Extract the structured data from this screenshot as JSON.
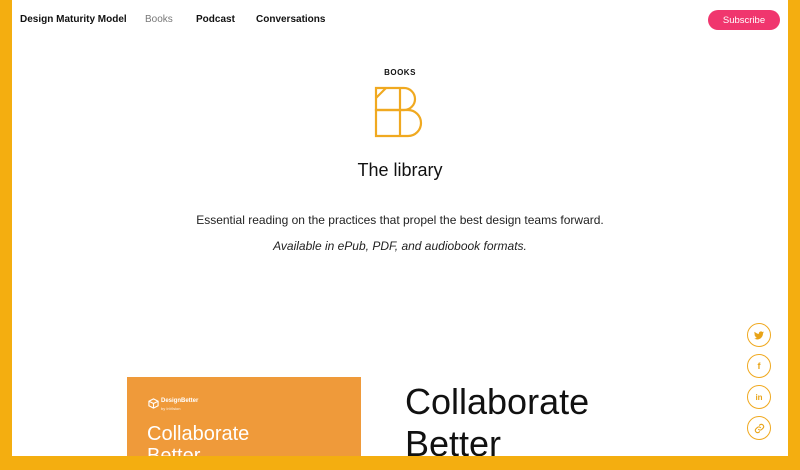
{
  "nav": {
    "brand": "Design Maturity Model",
    "items": [
      "Books",
      "Podcast",
      "Conversations"
    ],
    "subscribe": "Subscribe"
  },
  "header": {
    "eyebrow": "BOOKS",
    "title": "The library",
    "description": "Essential reading on the practices that propel the best design teams forward.",
    "formats": "Available in ePub, PDF, and audiobook formats."
  },
  "social": [
    {
      "icon": "twitter-icon",
      "glyph": "🐦"
    },
    {
      "icon": "facebook-icon",
      "glyph": "f"
    },
    {
      "icon": "linkedin-icon",
      "glyph": "in"
    },
    {
      "icon": "link-icon",
      "glyph": "🔗"
    }
  ],
  "book": {
    "cover_brand": "DesignBetter",
    "cover_sub": "by InVision",
    "cover_title_line1": "Collaborate",
    "cover_title_line2": "Better",
    "title_line1": "Collaborate",
    "title_line2": "Better"
  },
  "colors": {
    "frame": "#F4AE10",
    "accent": "#F0366E",
    "logo": "#F0A920",
    "cover": "#EF9A3A"
  }
}
